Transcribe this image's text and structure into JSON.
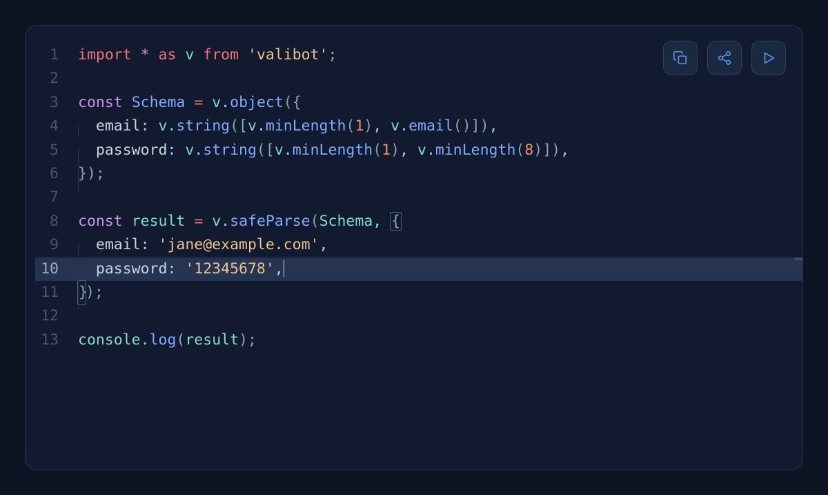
{
  "toolbar": {
    "copy": "copy-icon",
    "share": "share-icon",
    "play": "play-icon"
  },
  "editor": {
    "highlighted_line": 10,
    "lines": [
      {
        "n": 1,
        "tokens": [
          {
            "t": "import",
            "c": "kw-red"
          },
          {
            "t": " "
          },
          {
            "t": "*",
            "c": "kw-purple"
          },
          {
            "t": " "
          },
          {
            "t": "as",
            "c": "kw-red"
          },
          {
            "t": " "
          },
          {
            "t": "v",
            "c": "ident-teal"
          },
          {
            "t": " "
          },
          {
            "t": "from",
            "c": "kw-red"
          },
          {
            "t": " "
          },
          {
            "t": "'valibot'",
            "c": "str-yellow"
          },
          {
            "t": ";",
            "c": "punct"
          }
        ]
      },
      {
        "n": 2,
        "tokens": []
      },
      {
        "n": 3,
        "tokens": [
          {
            "t": "const",
            "c": "kw-purple"
          },
          {
            "t": " "
          },
          {
            "t": "Schema",
            "c": "ident-blue"
          },
          {
            "t": " "
          },
          {
            "t": "=",
            "c": "op-red"
          },
          {
            "t": " "
          },
          {
            "t": "v",
            "c": "ident-teal"
          },
          {
            "t": ".",
            "c": "op-cyan"
          },
          {
            "t": "object",
            "c": "fn-blue"
          },
          {
            "t": "({",
            "c": "punct"
          }
        ]
      },
      {
        "n": 4,
        "indent": 1,
        "tokens": [
          {
            "t": "email",
            "c": "prop-white"
          },
          {
            "t": ":",
            "c": "op-cyan"
          },
          {
            "t": " "
          },
          {
            "t": "v",
            "c": "ident-teal"
          },
          {
            "t": ".",
            "c": "op-cyan"
          },
          {
            "t": "string",
            "c": "fn-blue"
          },
          {
            "t": "([",
            "c": "punct"
          },
          {
            "t": "v",
            "c": "ident-teal"
          },
          {
            "t": ".",
            "c": "op-cyan"
          },
          {
            "t": "minLength",
            "c": "fn-blue"
          },
          {
            "t": "(",
            "c": "punct"
          },
          {
            "t": "1",
            "c": "num-orange"
          },
          {
            "t": ")",
            "c": "punct"
          },
          {
            "t": ",",
            "c": "op-cyan"
          },
          {
            "t": " "
          },
          {
            "t": "v",
            "c": "ident-teal"
          },
          {
            "t": ".",
            "c": "op-cyan"
          },
          {
            "t": "email",
            "c": "fn-blue"
          },
          {
            "t": "()])",
            "c": "punct"
          },
          {
            "t": ",",
            "c": "op-cyan"
          }
        ]
      },
      {
        "n": 5,
        "indent": 1,
        "tokens": [
          {
            "t": "password",
            "c": "prop-white"
          },
          {
            "t": ":",
            "c": "op-cyan"
          },
          {
            "t": " "
          },
          {
            "t": "v",
            "c": "ident-teal"
          },
          {
            "t": ".",
            "c": "op-cyan"
          },
          {
            "t": "string",
            "c": "fn-blue"
          },
          {
            "t": "([",
            "c": "punct"
          },
          {
            "t": "v",
            "c": "ident-teal"
          },
          {
            "t": ".",
            "c": "op-cyan"
          },
          {
            "t": "minLength",
            "c": "fn-blue"
          },
          {
            "t": "(",
            "c": "punct"
          },
          {
            "t": "1",
            "c": "num-orange"
          },
          {
            "t": ")",
            "c": "punct"
          },
          {
            "t": ",",
            "c": "op-cyan"
          },
          {
            "t": " "
          },
          {
            "t": "v",
            "c": "ident-teal"
          },
          {
            "t": ".",
            "c": "op-cyan"
          },
          {
            "t": "minLength",
            "c": "fn-blue"
          },
          {
            "t": "(",
            "c": "punct"
          },
          {
            "t": "8",
            "c": "num-orange"
          },
          {
            "t": ")])",
            "c": "punct"
          },
          {
            "t": ",",
            "c": "op-cyan"
          }
        ]
      },
      {
        "n": 6,
        "tokens": [
          {
            "t": "}",
            "c": "punct",
            "guide": true
          },
          {
            "t": ")",
            "c": "punct"
          },
          {
            "t": ";",
            "c": "punct"
          }
        ]
      },
      {
        "n": 7,
        "tokens": []
      },
      {
        "n": 8,
        "tokens": [
          {
            "t": "const",
            "c": "kw-purple"
          },
          {
            "t": " "
          },
          {
            "t": "result",
            "c": "ident-teal"
          },
          {
            "t": " "
          },
          {
            "t": "=",
            "c": "op-red"
          },
          {
            "t": " "
          },
          {
            "t": "v",
            "c": "ident-teal"
          },
          {
            "t": ".",
            "c": "op-cyan"
          },
          {
            "t": "safeParse",
            "c": "fn-blue"
          },
          {
            "t": "(",
            "c": "punct"
          },
          {
            "t": "Schema",
            "c": "ident-teal"
          },
          {
            "t": ",",
            "c": "op-cyan"
          },
          {
            "t": " "
          },
          {
            "t": "{",
            "c": "punct",
            "hl": true
          }
        ]
      },
      {
        "n": 9,
        "indent": 1,
        "tokens": [
          {
            "t": "email",
            "c": "prop-white"
          },
          {
            "t": ":",
            "c": "op-cyan"
          },
          {
            "t": " "
          },
          {
            "t": "'jane@example.com'",
            "c": "str-yellow"
          },
          {
            "t": ",",
            "c": "op-cyan"
          }
        ]
      },
      {
        "n": 10,
        "indent": 1,
        "cursor": true,
        "tokens": [
          {
            "t": "password",
            "c": "prop-white"
          },
          {
            "t": ":",
            "c": "op-cyan"
          },
          {
            "t": " "
          },
          {
            "t": "'12345678'",
            "c": "str-yellow"
          },
          {
            "t": ",",
            "c": "op-cyan"
          }
        ]
      },
      {
        "n": 11,
        "tokens": [
          {
            "t": "}",
            "c": "punct",
            "guide": true,
            "hl": true
          },
          {
            "t": ")",
            "c": "punct"
          },
          {
            "t": ";",
            "c": "punct"
          }
        ]
      },
      {
        "n": 12,
        "tokens": []
      },
      {
        "n": 13,
        "tokens": [
          {
            "t": "console",
            "c": "ident-teal"
          },
          {
            "t": ".",
            "c": "op-cyan"
          },
          {
            "t": "log",
            "c": "fn-blue"
          },
          {
            "t": "(",
            "c": "punct"
          },
          {
            "t": "result",
            "c": "ident-teal"
          },
          {
            "t": ")",
            "c": "punct"
          },
          {
            "t": ";",
            "c": "punct"
          }
        ]
      }
    ]
  }
}
